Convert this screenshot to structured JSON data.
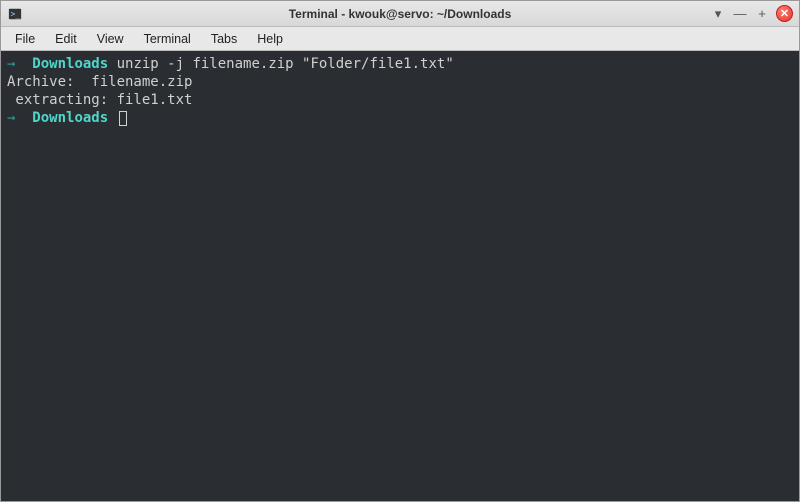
{
  "titlebar": {
    "title": "Terminal - kwouk@servo: ~/Downloads"
  },
  "menubar": {
    "file": "File",
    "edit": "Edit",
    "view": "View",
    "terminal": "Terminal",
    "tabs": "Tabs",
    "help": "Help"
  },
  "terminal": {
    "arrow1": "→",
    "dir1": "Downloads",
    "cmd1": "unzip -j filename.zip \"Folder/file1.txt\"",
    "out1": "Archive:  filename.zip",
    "out2": " extracting: file1.txt",
    "arrow2": "→",
    "dir2": "Downloads"
  },
  "controls": {
    "minimize": "▾",
    "restore": "—",
    "maximize": "+",
    "close": "✕"
  }
}
